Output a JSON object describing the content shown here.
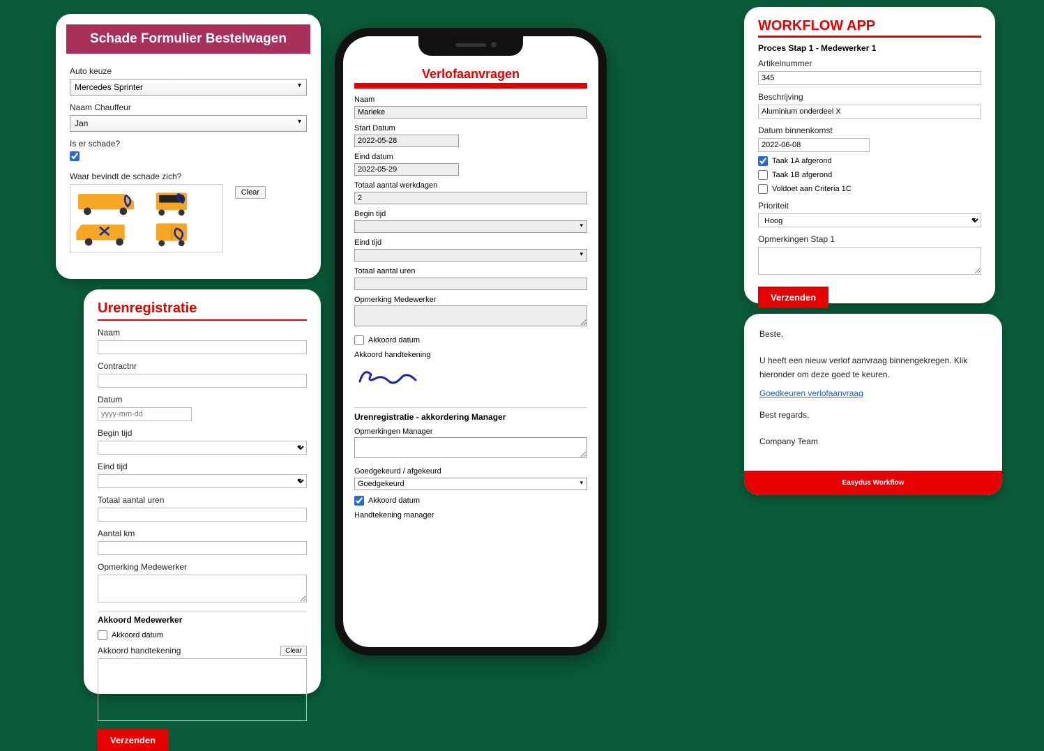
{
  "card1": {
    "title": "Schade Formulier Bestelwagen",
    "auto_label": "Auto keuze",
    "auto_value": "Mercedes Sprinter",
    "chauffeur_label": "Naam Chauffeur",
    "chauffeur_value": "Jan",
    "schade_q": "Is er schade?",
    "waar_q": "Waar bevindt de schade zich?",
    "clear": "Clear"
  },
  "card2": {
    "title": "Urenregistratie",
    "naam": "Naam",
    "contract": "Contractnr",
    "datum": "Datum",
    "datum_ph": "yyyy-mm-dd",
    "begin": "Begin tijd",
    "eind": "Eind tijd",
    "totaal": "Totaal aantal uren",
    "km": "Aantal km",
    "opm": "Opmerking Medewerker",
    "akk_head": "Akkoord Medewerker",
    "akk_datum": "Akkoord datum",
    "akk_sig": "Akkoord handtekening",
    "clear": "Clear",
    "send": "Verzenden"
  },
  "phone": {
    "title": "Verlofaanvragen",
    "naam_l": "Naam",
    "naam_v": "Marieke",
    "start_l": "Start Datum",
    "start_v": "2022-05-28",
    "eind_l": "Eind datum",
    "eind_v": "2022-05-29",
    "werk_l": "Totaal aantal werkdagen",
    "werk_v": "2",
    "begin_l": "Begin tijd",
    "eindt_l": "Eind tijd",
    "uren_l": "Totaal aantal uren",
    "opm_l": "Opmerking Medewerker",
    "akk_datum": "Akkoord datum",
    "akk_sig": "Akkoord handtekening",
    "sec2": "Urenregistratie - akkordering Manager",
    "opm_mgr": "Opmerkingen Manager",
    "goed_l": "Goedgekeurd / afgekeurd",
    "goed_v": "Goedgekeurd",
    "akk_datum2": "Akkoord datum",
    "sig_mgr": "Handtekening manager"
  },
  "card3": {
    "title": "WORKFLOW APP",
    "step": "Proces Stap 1 - Medewerker 1",
    "art_l": "Artikelnummer",
    "art_v": "345",
    "besch_l": "Beschrijving",
    "besch_v": "Aluminium onderdeel X",
    "dat_l": "Datum binnenkomst",
    "dat_v": "2022-06-08",
    "t1a": "Taak 1A afgerond",
    "t1b": "Taak 1B afgerond",
    "t1c": "Voldoet aan Criteria 1C",
    "prio_l": "Prioriteit",
    "prio_v": "Hoog",
    "opm_l": "Opmerkingen Stap 1",
    "send": "Verzenden"
  },
  "card4": {
    "greet": "Beste,",
    "body": "U heeft een nieuw verlof aanvraag binnengekregen. Klik hieronder om deze goed te keuren.",
    "link": "Goedkeuren verlofaanvraag",
    "regards": "Best regards,",
    "team": "Company Team",
    "footer": "Easydus Workflow"
  }
}
